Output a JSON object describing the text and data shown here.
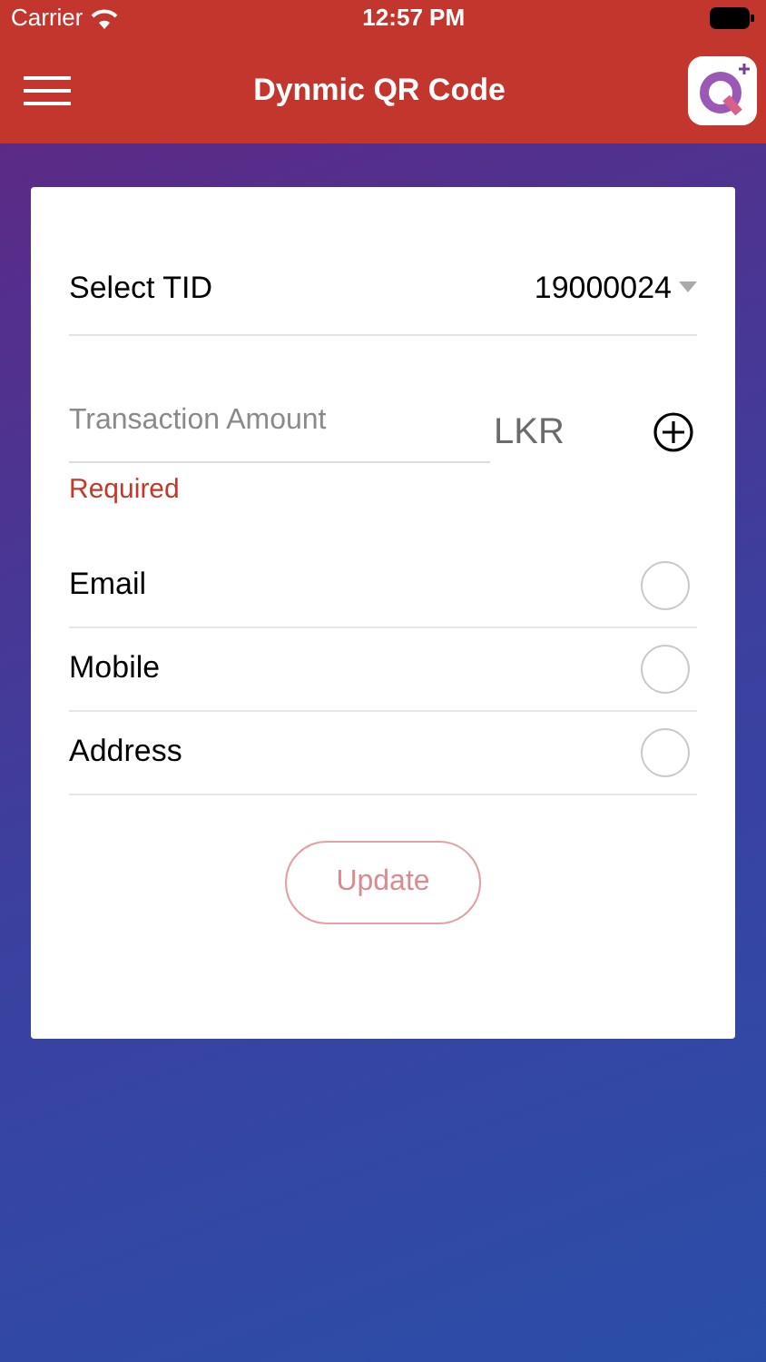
{
  "status_bar": {
    "carrier": "Carrier",
    "time": "12:57 PM"
  },
  "nav": {
    "title": "Dynmic QR Code"
  },
  "form": {
    "tid": {
      "label": "Select TID",
      "value": "19000024"
    },
    "amount": {
      "placeholder": "Transaction Amount",
      "currency": "LKR",
      "error": "Required"
    },
    "options": [
      {
        "label": "Email",
        "selected": false
      },
      {
        "label": "Mobile",
        "selected": false
      },
      {
        "label": "Address",
        "selected": false
      }
    ],
    "button": {
      "label": "Update",
      "disabled": true
    }
  }
}
